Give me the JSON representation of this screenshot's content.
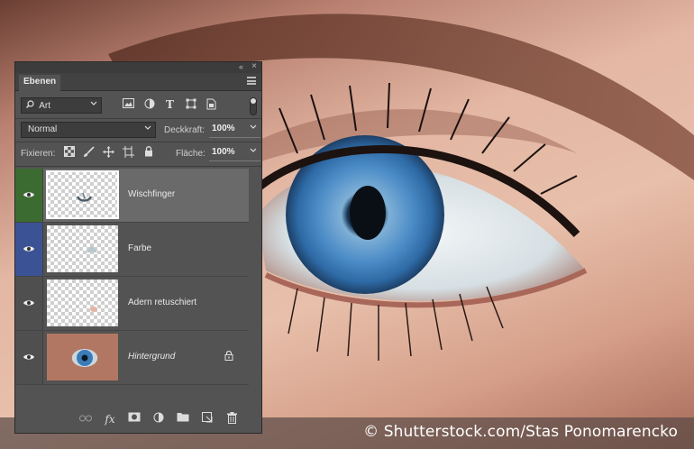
{
  "panel": {
    "collapse_glyph": "«",
    "close_glyph": "×",
    "tab_label": "Ebenen",
    "filter": {
      "label": "Art",
      "chevron": "⌄"
    },
    "blend_mode": "Normal",
    "opacity_label": "Deckkraft:",
    "opacity_value": "100%",
    "lock_label": "Fixieren:",
    "fill_label": "Fläche:",
    "fill_value": "100%",
    "layers": [
      {
        "name": "Wischfinger",
        "visible": true,
        "selected": true,
        "locked": false
      },
      {
        "name": "Farbe",
        "visible": true,
        "selected": false,
        "locked": false
      },
      {
        "name": "Adern retuschiert",
        "visible": true,
        "selected": false,
        "locked": false
      },
      {
        "name": "Hintergrund",
        "visible": true,
        "selected": false,
        "locked": true
      }
    ],
    "visibility_colors": [
      "#3c6b32",
      "#3b5394",
      "#4f4f4f",
      "#4f4f4f"
    ],
    "icons": {
      "filter": [
        "image-filter-icon",
        "adjustment-filter-icon",
        "type-filter-icon",
        "shape-filter-icon",
        "smart-object-filter-icon"
      ],
      "lock": [
        "lock-transparent-pixels-icon",
        "lock-image-pixels-icon",
        "lock-position-icon",
        "lock-artboard-icon",
        "lock-all-icon"
      ],
      "bottom": [
        "link-layers-icon",
        "fx-icon",
        "add-mask-icon",
        "adjustment-layer-icon",
        "new-group-icon",
        "new-layer-icon",
        "trash-icon"
      ]
    },
    "glyphs": {
      "type_filter": "T",
      "fx": "fx"
    }
  },
  "credit": "© Shutterstock.com/Stas Ponomarencko"
}
